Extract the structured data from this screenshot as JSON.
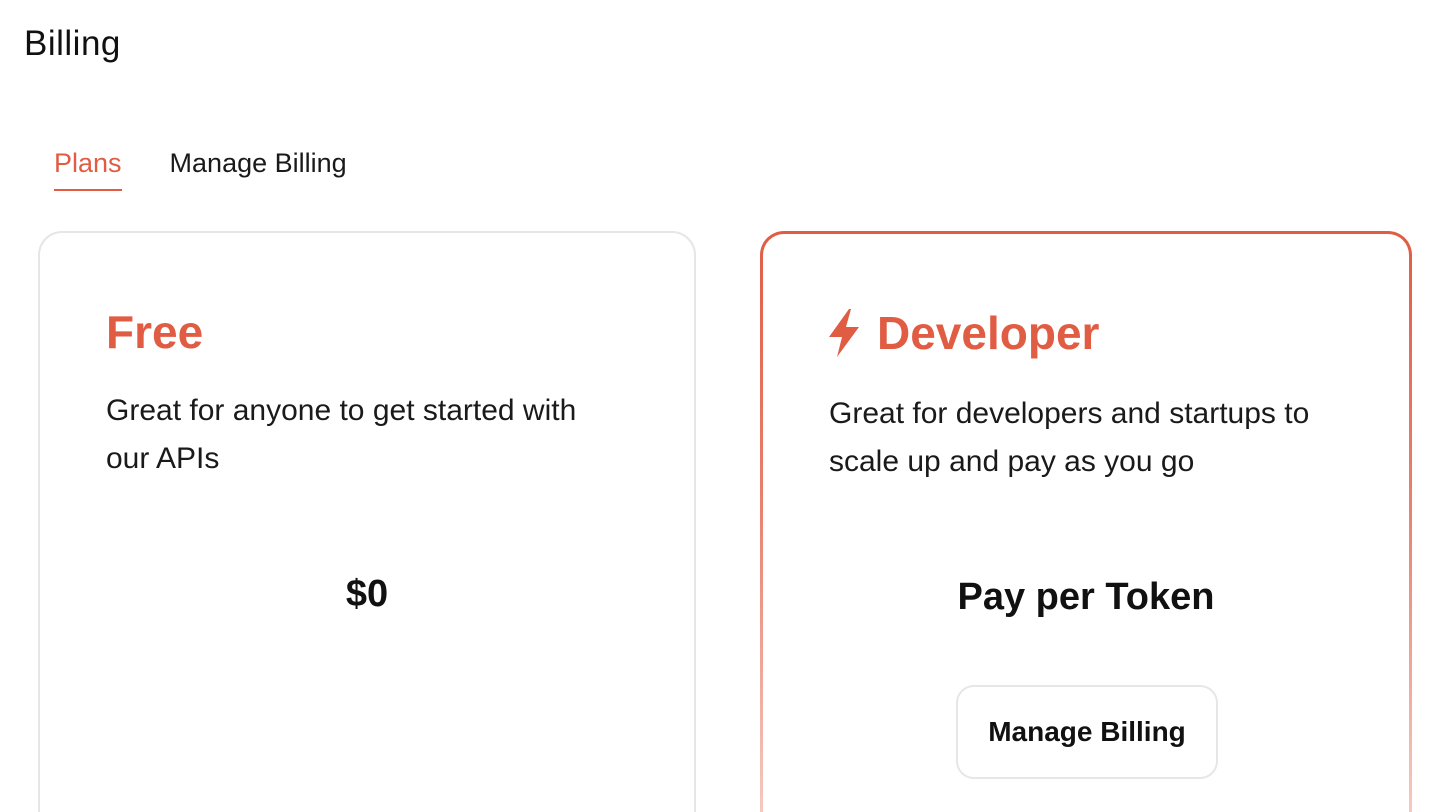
{
  "header": {
    "title": "Billing"
  },
  "tabs": [
    {
      "label": "Plans",
      "active": true
    },
    {
      "label": "Manage Billing",
      "active": false
    }
  ],
  "plans": {
    "free": {
      "name": "Free",
      "description": "Great for anyone to get started with our APIs",
      "price": "$0"
    },
    "developer": {
      "icon": "lightning-bolt-icon",
      "name": "Developer",
      "description": "Great for developers and startups to scale up and pay as you go",
      "price": "Pay per Token",
      "button_label": "Manage Billing"
    }
  },
  "colors": {
    "accent": "#e05d44",
    "border": "#e6e6e6"
  }
}
